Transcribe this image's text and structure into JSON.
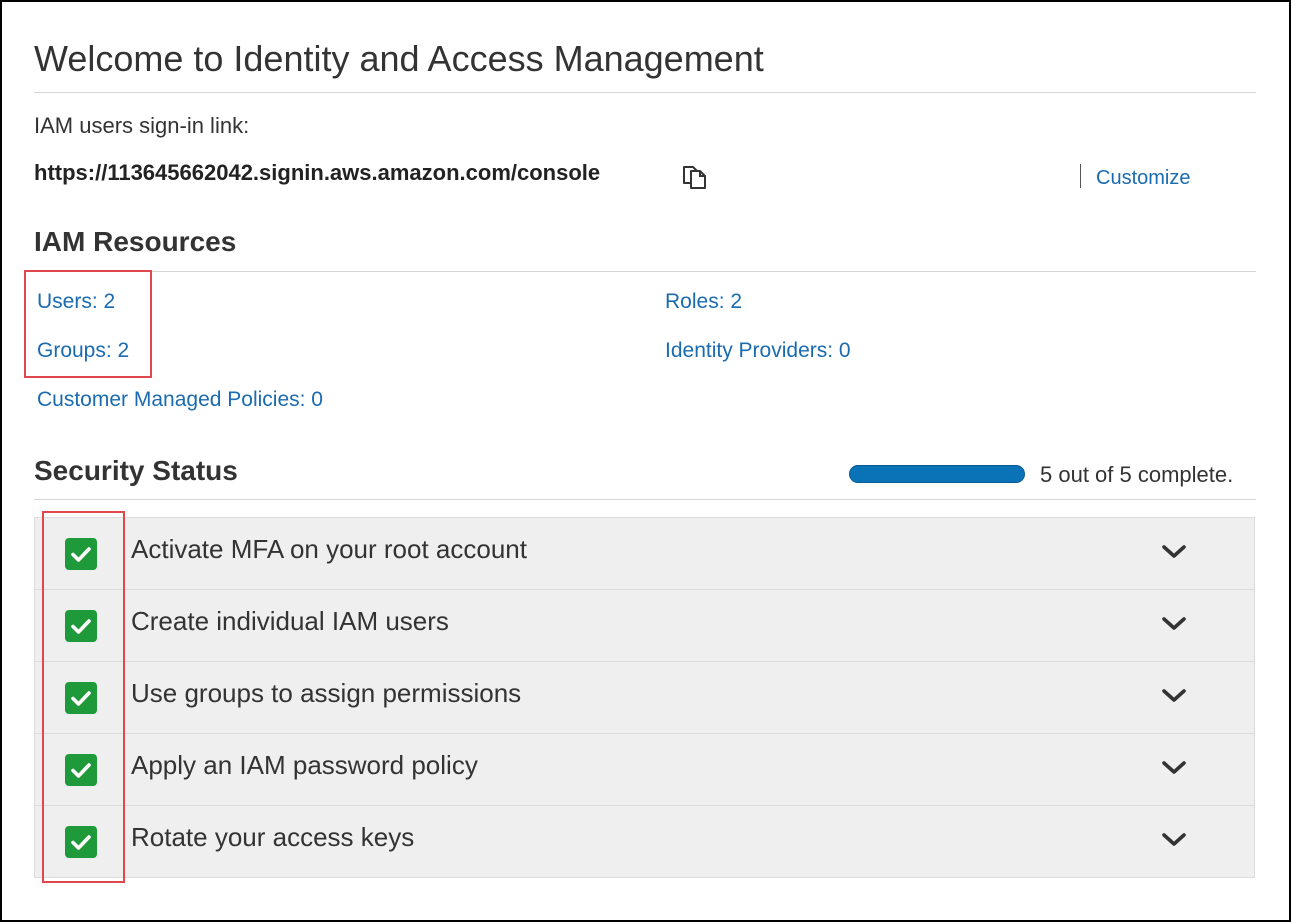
{
  "header": {
    "title": "Welcome to Identity and Access Management"
  },
  "signin": {
    "label": "IAM users sign-in link:",
    "url": "https://113645662042.signin.aws.amazon.com/console",
    "copy_icon": "copy-icon",
    "customize_label": "Customize"
  },
  "resources": {
    "title": "IAM Resources",
    "users": "Users: 2",
    "roles": "Roles: 2",
    "groups": "Groups: 2",
    "identity_providers": "Identity Providers: 0",
    "customer_managed_policies": "Customer Managed Policies: 0"
  },
  "security": {
    "title": "Security Status",
    "progress_fraction": 1.0,
    "progress_text": "5 out of 5 complete.",
    "items": [
      {
        "label": "Activate MFA on your root account",
        "complete": true
      },
      {
        "label": "Create individual IAM users",
        "complete": true
      },
      {
        "label": "Use groups to assign permissions",
        "complete": true
      },
      {
        "label": "Apply an IAM password policy",
        "complete": true
      },
      {
        "label": "Rotate your access keys",
        "complete": true
      }
    ]
  },
  "colors": {
    "link": "#1a6bb0",
    "check": "#1f9a3a",
    "progress": "#0a73b8",
    "highlight": "#e0474c"
  }
}
